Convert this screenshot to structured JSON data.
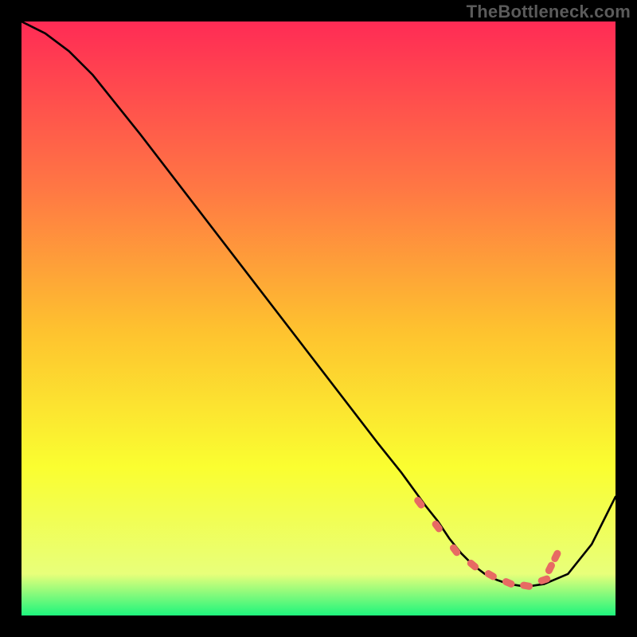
{
  "watermark": "TheBottleneck.com",
  "chart_data": {
    "type": "line",
    "title": "",
    "xlabel": "",
    "ylabel": "",
    "xlim": [
      0,
      100
    ],
    "ylim": [
      0,
      100
    ],
    "legend": false,
    "grid": false,
    "background_gradient": {
      "top_color": "#ff2b55",
      "mid_upper_color": "#ff7744",
      "mid_color": "#fec22f",
      "mid_lower_color": "#fafe30",
      "near_bottom_color": "#e8ff7a",
      "bottom_color": "#1ef57d"
    },
    "series": [
      {
        "name": "bottleneck-curve",
        "type": "line",
        "color": "#000000",
        "x": [
          0,
          4,
          8,
          12,
          20,
          30,
          40,
          50,
          60,
          64,
          68,
          70,
          72,
          74,
          76,
          78,
          80,
          82,
          84,
          86,
          88,
          92,
          96,
          100
        ],
        "y": [
          100,
          98,
          95,
          91,
          81,
          68,
          55,
          42,
          29,
          24,
          18.5,
          16,
          13,
          10.5,
          8.5,
          7,
          6,
          5.3,
          5,
          5,
          5.3,
          7,
          12,
          20
        ]
      },
      {
        "name": "sweet-spot-markers",
        "type": "scatter",
        "color": "#e76a63",
        "x": [
          67,
          70,
          73,
          76,
          79,
          82,
          85,
          88,
          89,
          90
        ],
        "y": [
          19,
          15,
          11,
          8.5,
          6.8,
          5.5,
          5,
          6,
          8,
          10
        ]
      }
    ]
  }
}
